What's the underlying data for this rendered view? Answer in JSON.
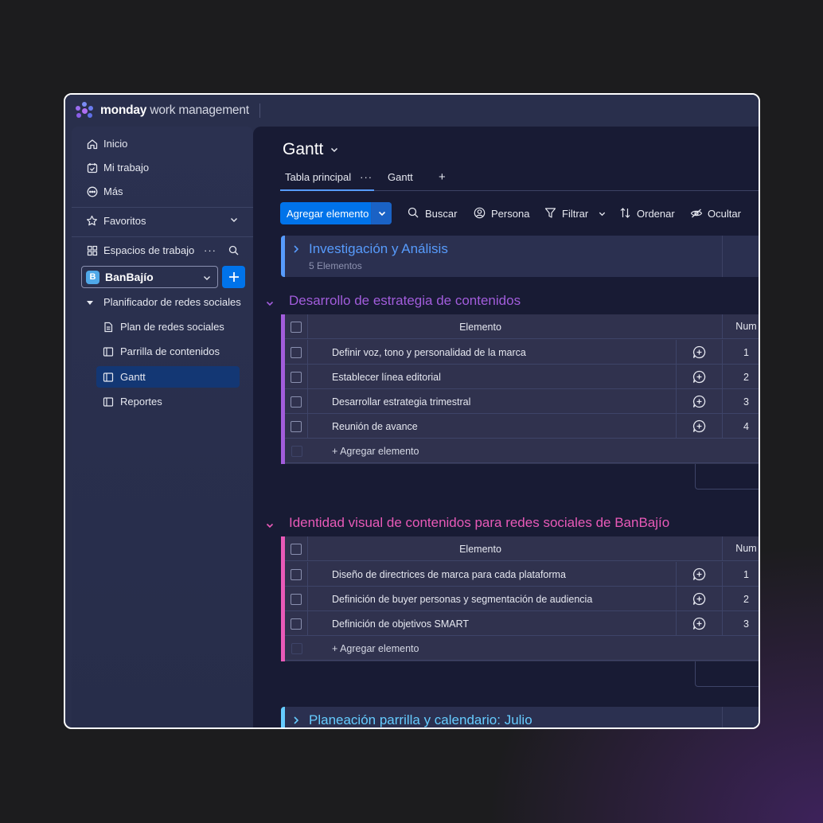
{
  "app": {
    "brand_bold": "monday",
    "brand_rest": "work management"
  },
  "sidebar": {
    "nav": [
      {
        "label": "Inicio",
        "icon": "home-icon"
      },
      {
        "label": "Mi trabajo",
        "icon": "calendar-check-icon"
      },
      {
        "label": "Más",
        "icon": "more-circle-icon"
      }
    ],
    "favorites_label": "Favoritos",
    "workspaces_label": "Espacios de trabajo",
    "workspace": {
      "badge": "B",
      "name": "BanBajío"
    },
    "folder": "Planificador de redes sociales",
    "boards": [
      {
        "label": "Plan de redes sociales",
        "icon": "document-icon"
      },
      {
        "label": "Parrilla de contenidos",
        "icon": "board-icon"
      },
      {
        "label": "Gantt",
        "icon": "board-icon",
        "active": true
      },
      {
        "label": "Reportes",
        "icon": "board-icon"
      }
    ]
  },
  "board": {
    "title": "Gantt",
    "tabs": [
      {
        "label": "Tabla principal",
        "active": true
      },
      {
        "label": "Gantt"
      }
    ],
    "add_tab": "+"
  },
  "toolbar": {
    "new_item": "Agregar elemento",
    "search": "Buscar",
    "person": "Persona",
    "filter": "Filtrar",
    "sort": "Ordenar",
    "hide": "Ocultar"
  },
  "groups": {
    "g1": {
      "name": "Investigación y Análisis",
      "count": "5 Elementos",
      "color": "#579bfc"
    },
    "g2": {
      "name": "Desarrollo de estrategia de contenidos",
      "color": "#9d50dd",
      "col_item": "Elemento",
      "col_num": "Num",
      "rows": [
        {
          "name": "Definir voz, tono y personalidad de la marca",
          "num": "1"
        },
        {
          "name": "Establecer línea editorial",
          "num": "2"
        },
        {
          "name": "Desarrollar estrategia trimestral",
          "num": "3"
        },
        {
          "name": "Reunión de avance",
          "num": "4"
        }
      ],
      "add": "+ Agregar elemento"
    },
    "g3": {
      "name": "Identidad visual de contenidos para redes sociales de BanBajío",
      "color": "#e95ab8",
      "col_item": "Elemento",
      "col_num": "Num",
      "rows": [
        {
          "name": "Diseño de directrices de marca para cada plataforma",
          "num": "1"
        },
        {
          "name": "Definición de buyer personas y segmentación de audiencia",
          "num": "2"
        },
        {
          "name": "Definición de objetivos SMART",
          "num": "3"
        }
      ],
      "add": "+ Agregar elemento"
    },
    "g4": {
      "name": "Planeación parrilla y calendario: Julio",
      "color": "#66ccff"
    }
  }
}
